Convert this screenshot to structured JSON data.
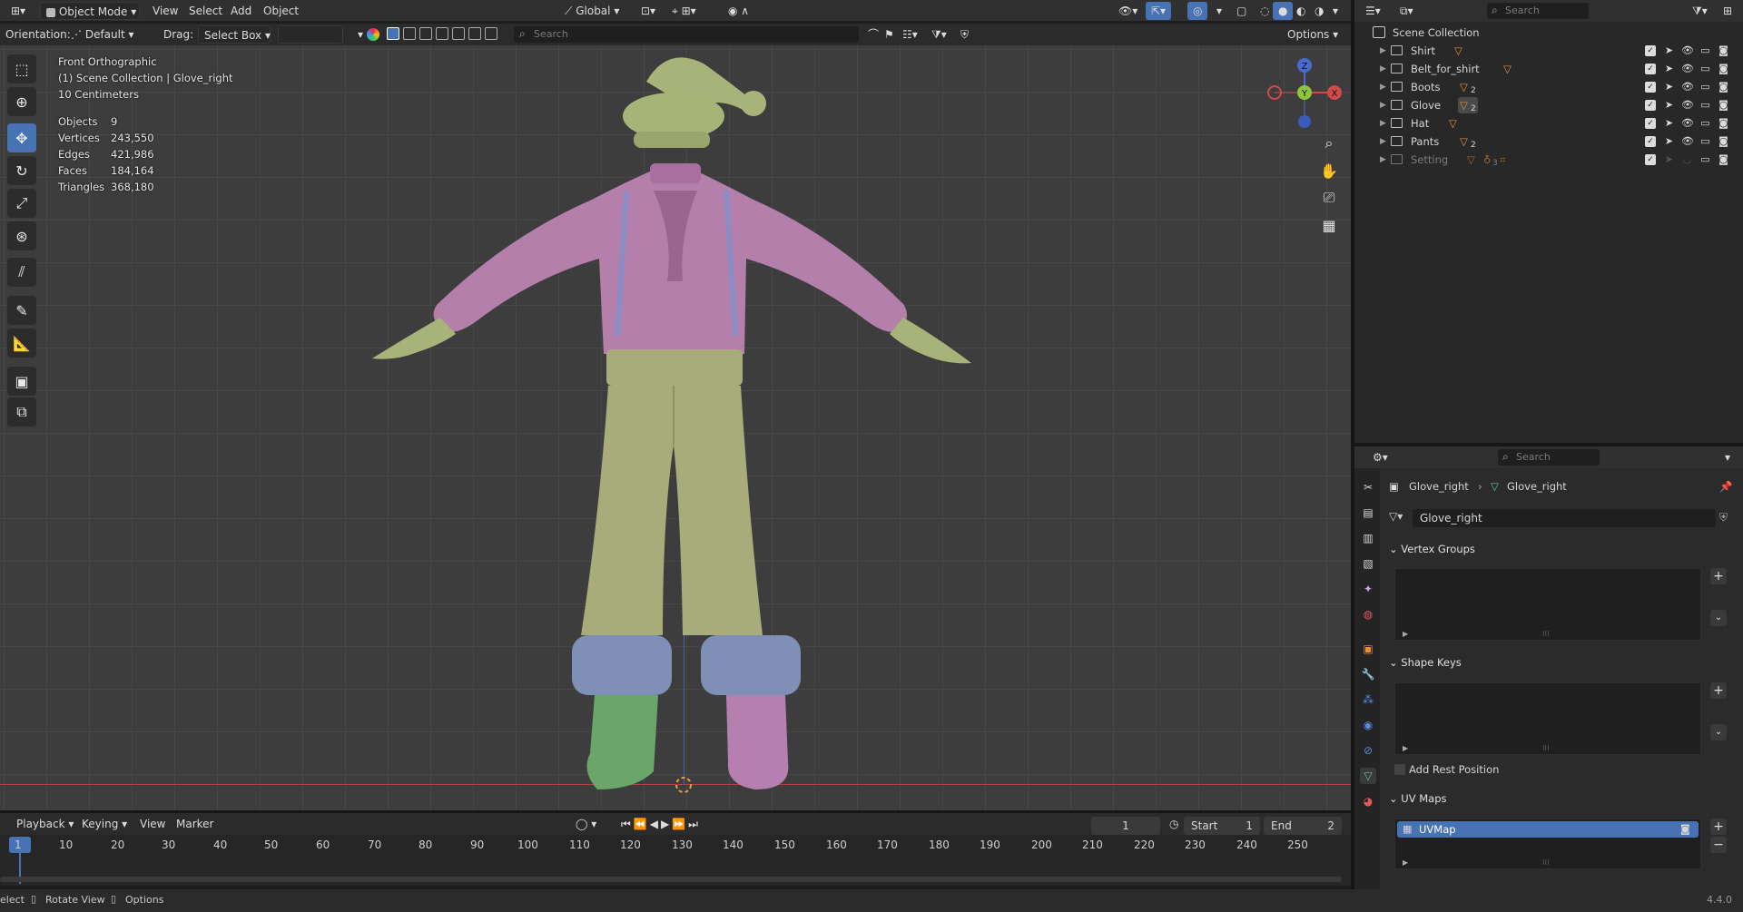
{
  "header": {
    "mode": "Object Mode",
    "menus": [
      "View",
      "Select",
      "Add",
      "Object"
    ],
    "transform_orientation": "Global",
    "orientation_label": "Orientation:",
    "orientation_value": "Default",
    "drag_label": "Drag:",
    "drag_value": "Select Box",
    "search_placeholder": "Search",
    "options": "Options"
  },
  "viewport": {
    "view_name": "Front Orthographic",
    "collection_info": "(1) Scene Collection | Glove_right",
    "scale": "10 Centimeters",
    "stats": [
      {
        "label": "Objects",
        "value": "9"
      },
      {
        "label": "Vertices",
        "value": "243,550"
      },
      {
        "label": "Edges",
        "value": "421,986"
      },
      {
        "label": "Faces",
        "value": "184,164"
      },
      {
        "label": "Triangles",
        "value": "368,180"
      }
    ],
    "gizmo": {
      "z": "Z",
      "y": "Y",
      "x": "X"
    }
  },
  "timeline": {
    "menus": [
      "Playback",
      "Keying",
      "View",
      "Marker"
    ],
    "current_frame": "1",
    "start_label": "Start",
    "start_value": "1",
    "end_label": "End",
    "end_value": "2",
    "ticks": [
      "1",
      "10",
      "20",
      "30",
      "40",
      "50",
      "60",
      "70",
      "80",
      "90",
      "100",
      "110",
      "120",
      "130",
      "140",
      "150",
      "160",
      "170",
      "180",
      "190",
      "200",
      "210",
      "220",
      "230",
      "240",
      "250"
    ]
  },
  "status": {
    "select": "elect",
    "rotate": "Rotate View",
    "options": "Options",
    "version": "4.4.0"
  },
  "outliner": {
    "search_placeholder": "Search",
    "root": "Scene Collection",
    "items": [
      {
        "name": "Shirt",
        "badge": ""
      },
      {
        "name": "Belt_for_shirt",
        "badge": ""
      },
      {
        "name": "Boots",
        "badge": "2"
      },
      {
        "name": "Glove",
        "badge": "2"
      },
      {
        "name": "Hat",
        "badge": ""
      },
      {
        "name": "Pants",
        "badge": "2"
      },
      {
        "name": "Setting",
        "badge": "3"
      }
    ]
  },
  "properties": {
    "search_placeholder": "Search",
    "breadcrumb_object": "Glove_right",
    "breadcrumb_mesh": "Glove_right",
    "mesh_name": "Glove_right",
    "panels": {
      "vertex_groups": "Vertex Groups",
      "shape_keys": "Shape Keys",
      "add_rest_position": "Add Rest Position",
      "uv_maps": "UV Maps",
      "uv_map_item": "UVMap"
    }
  },
  "colors": {
    "active_blue": "#4772b3",
    "shirt": "#b57fab",
    "pants": "#a8ab7a",
    "fur": "#7f8fb5",
    "boot_green": "#6aa56a",
    "boot_pink": "#b57fb0"
  }
}
